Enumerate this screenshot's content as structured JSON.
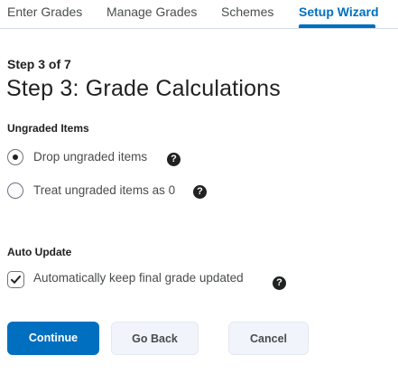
{
  "tabs": [
    {
      "label": "Enter Grades"
    },
    {
      "label": "Manage Grades"
    },
    {
      "label": "Schemes"
    },
    {
      "label": "Setup Wizard",
      "active": true
    }
  ],
  "step": {
    "label": "Step 3 of 7",
    "title": "Step 3: Grade Calculations"
  },
  "ungraded": {
    "heading": "Ungraded Items",
    "options": [
      {
        "label": "Drop ungraded items",
        "selected": true
      },
      {
        "label": "Treat ungraded items as 0",
        "selected": false
      }
    ]
  },
  "auto_update": {
    "heading": "Auto Update",
    "checkbox_label": "Automatically keep final grade updated",
    "checked": true
  },
  "help_glyph": "?",
  "buttons": {
    "continue": "Continue",
    "go_back": "Go Back",
    "cancel": "Cancel"
  },
  "icons": {
    "help": "help-circle-icon",
    "check": "checkmark-icon"
  },
  "colors": {
    "accent": "#006fbf",
    "text": "#202122",
    "secondary_button_bg": "#f1f5fb"
  }
}
